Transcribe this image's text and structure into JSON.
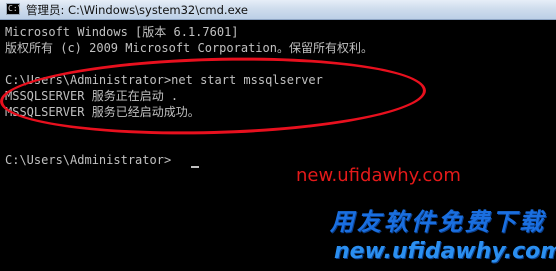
{
  "window": {
    "title": "管理员: C:\\Windows\\system32\\cmd.exe",
    "icon": "cmd-icon",
    "icon_glyph": "C:\\"
  },
  "console": {
    "lines": [
      "Microsoft Windows [版本 6.1.7601]",
      "版权所有 (c) 2009 Microsoft Corporation。保留所有权利。",
      "",
      "C:\\Users\\Administrator>net start mssqlserver",
      "MSSQLSERVER 服务正在启动 .",
      "MSSQLSERVER 服务已经启动成功。",
      "",
      "",
      "C:\\Users\\Administrator>"
    ]
  },
  "colors": {
    "console_bg": "#000000",
    "console_text": "#c0c0c0",
    "highlight": "#e8101e",
    "watermark_red": "#e41a1a",
    "watermark_blue": "#1a6fe0"
  },
  "watermark": {
    "url_top": "new.ufidawhy.com",
    "brand": "用友软件免费下载",
    "url_bottom": "new.ufidawhy.com"
  }
}
